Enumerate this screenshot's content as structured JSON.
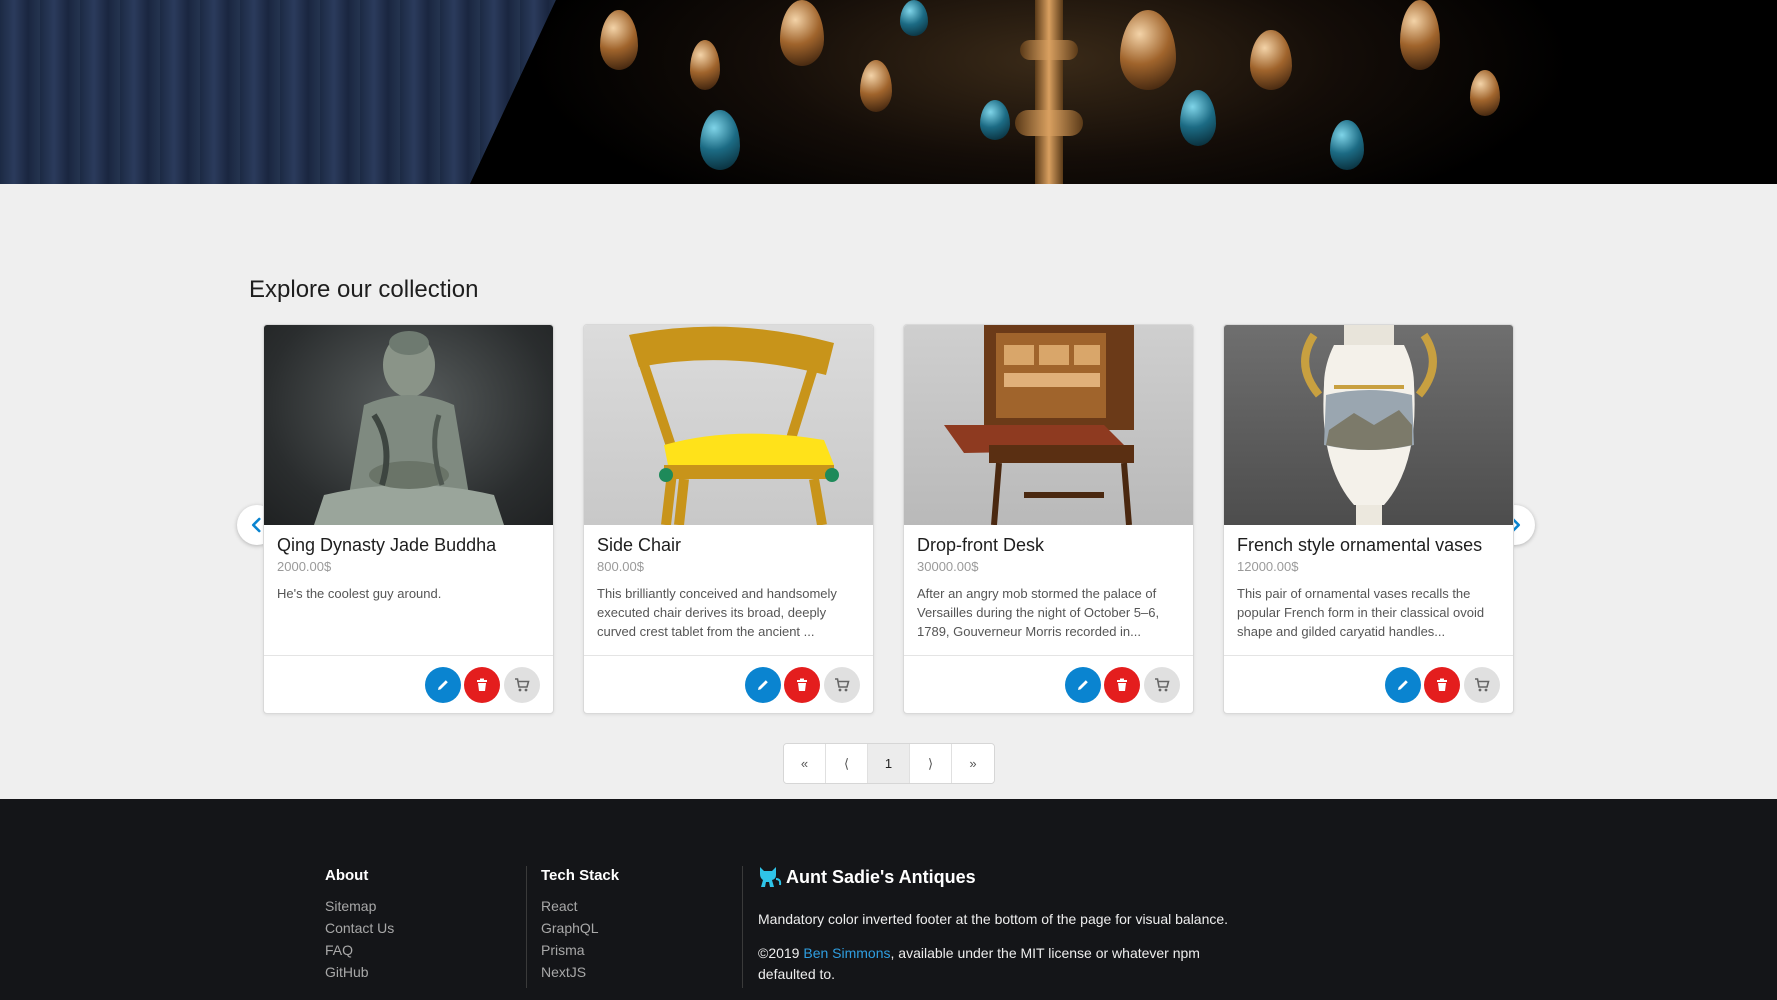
{
  "section": {
    "title": "Explore our collection"
  },
  "cards": [
    {
      "title": "Qing Dynasty Jade Buddha",
      "price": "2000.00$",
      "description": "He's the coolest guy around."
    },
    {
      "title": "Side Chair",
      "price": "800.00$",
      "description": "This brilliantly conceived and handsomely executed chair derives its broad, deeply curved crest tablet from the ancient ..."
    },
    {
      "title": "Drop-front Desk",
      "price": "30000.00$",
      "description": "After an angry mob stormed the palace of Versailles during the night of October 5–6, 1789, Gouverneur Morris recorded in..."
    },
    {
      "title": "French style ornamental vases",
      "price": "12000.00$",
      "description": "This pair of ornamental vases recalls the popular French form in their classical ovoid shape and gilded caryatid handles..."
    }
  ],
  "pagination": {
    "first": "«",
    "prev": "⟨",
    "current": "1",
    "next": "⟩",
    "last": "»"
  },
  "footer": {
    "about": {
      "heading": "About",
      "links": [
        "Sitemap",
        "Contact Us",
        "FAQ",
        "GitHub"
      ]
    },
    "tech": {
      "heading": "Tech Stack",
      "links": [
        "React",
        "GraphQL",
        "Prisma",
        "NextJS"
      ]
    },
    "brand": "Aunt Sadie's Antiques",
    "tagline": "Mandatory color inverted footer at the bottom of the page for visual balance.",
    "copyright_prefix": "©2019 ",
    "author": "Ben Simmons",
    "copyright_suffix": ", available under the MIT license or whatever npm defaulted to."
  },
  "colors": {
    "accent": "#0a84d0",
    "danger": "#e41e1e",
    "footer_bg": "#141518",
    "link": "#2f9ee0"
  },
  "icons": {
    "edit": "pencil-icon",
    "delete": "trash-icon",
    "cart": "cart-icon",
    "prev": "chevron-left-icon",
    "next": "chevron-right-icon",
    "brand": "cat-icon"
  }
}
